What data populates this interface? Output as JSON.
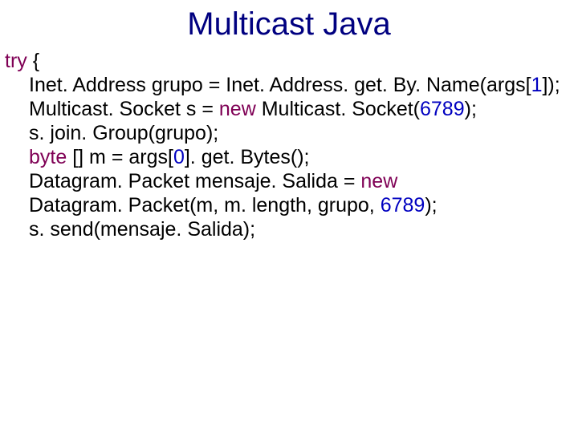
{
  "title": "Multicast Java",
  "code": {
    "l1_kw": "try",
    "l1_rest": " {",
    "l2_a": "Inet. Address grupo = Inet. Address. get. By. Name(args[",
    "l2_n": "1",
    "l2_b": "]);",
    "l3_a": "Multicast. Socket s = ",
    "l3_kw": "new",
    "l3_b": " Multicast. Socket(",
    "l3_n": "6789",
    "l3_c": ");",
    "l4": "s. join. Group(grupo);",
    "l5_kw": "byte",
    "l5_a": " [] m = args[",
    "l5_n": "0",
    "l5_b": "]. get. Bytes();",
    "l6_a": "Datagram. Packet mensaje. Salida = ",
    "l6_kw": "new",
    "l7_a": "Datagram. Packet(m, m. length, grupo, ",
    "l7_n": "6789",
    "l7_b": ");",
    "l8": "s. send(mensaje. Salida);"
  }
}
